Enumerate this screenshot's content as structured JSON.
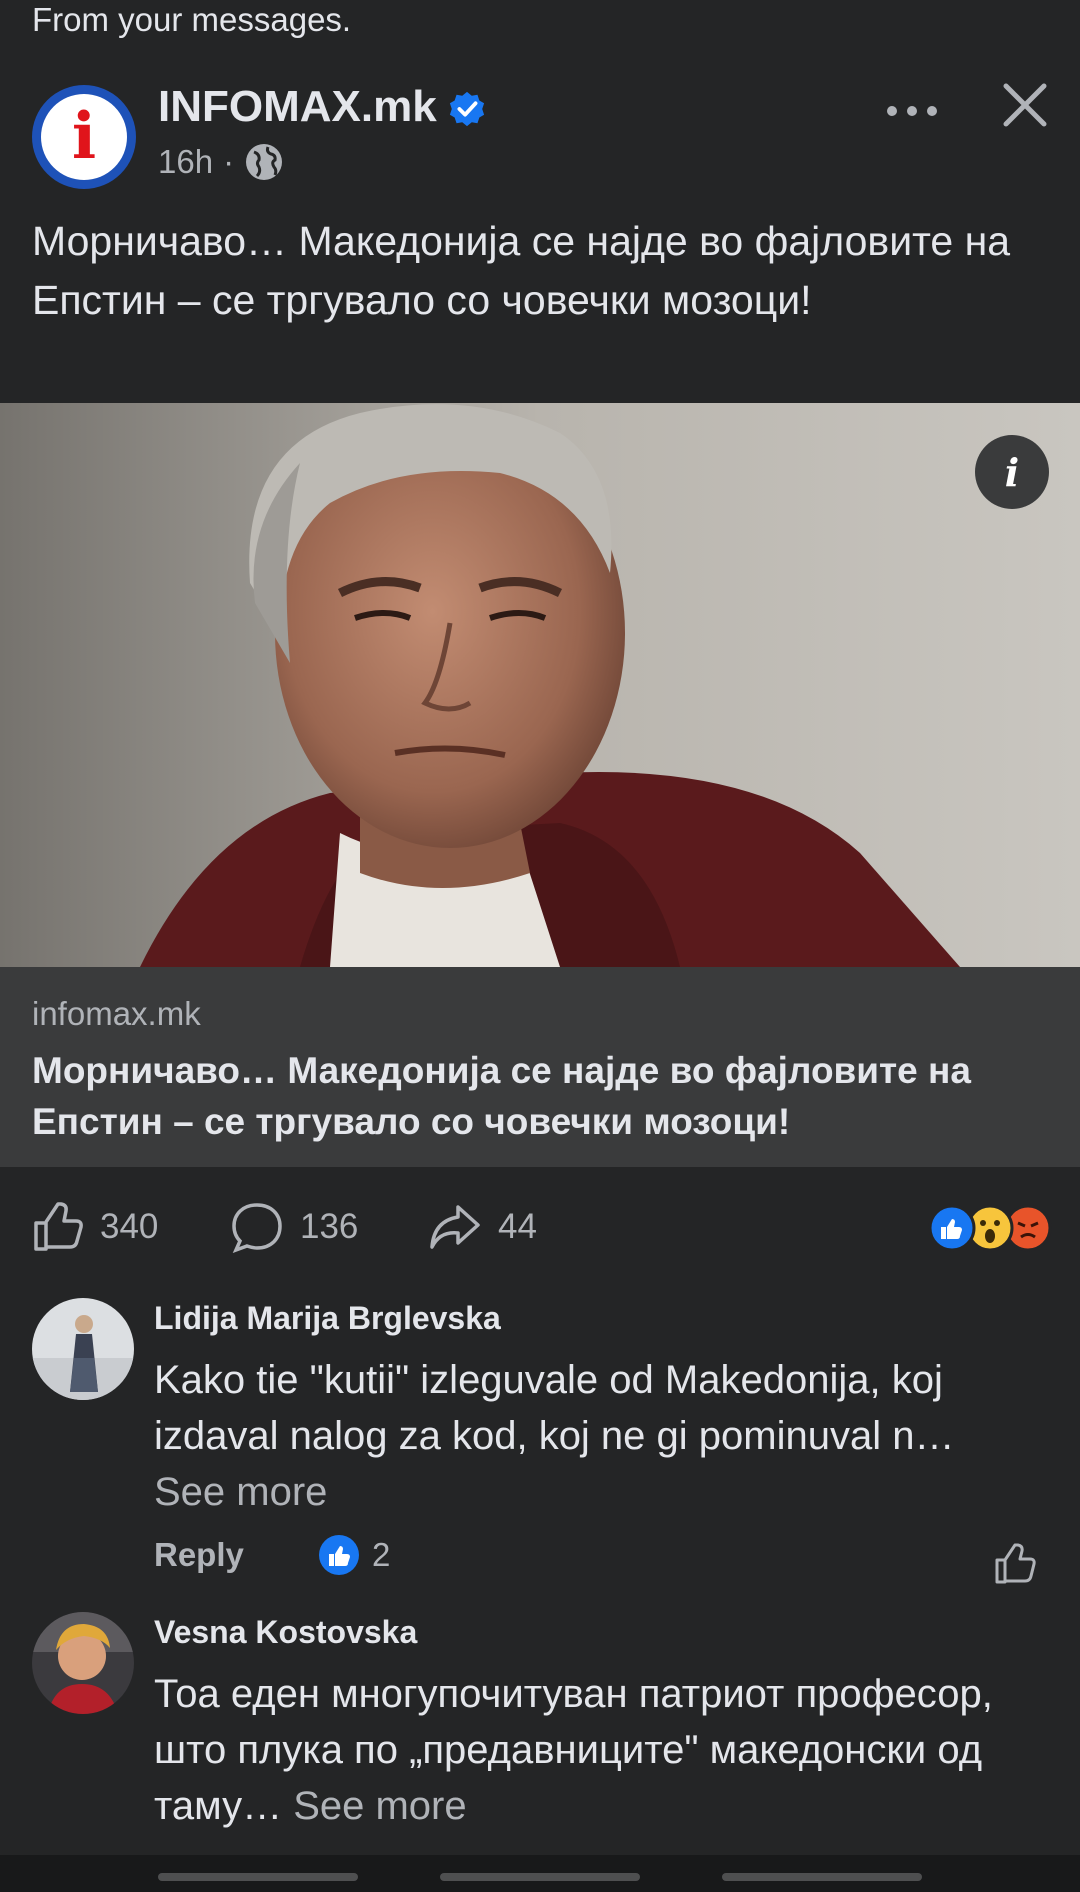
{
  "top_note": "From your messages.",
  "post": {
    "page_name": "INFOMAX.mk",
    "logo_letter": "i",
    "time": "16h",
    "separator": "·",
    "text": "Морничаво… Македонија се најде во фајловите на Епстин – се тргувало со човечки мозоци!",
    "link_domain": "infomax.mk",
    "link_title": "Морничаво… Македонија се најде во фајловите на Епстин – се тргувало со човечки мозоци!",
    "info_glyph": "i",
    "likes": "340",
    "comments": "136",
    "shares": "44"
  },
  "comments": [
    {
      "name": "Lidija Marija Brglevska",
      "text": "Kako tie \"kutii\" izleguvale od Makedonija, koj izdaval nalog za kod, koj ne gi pominuval n…",
      "see_more": "See more",
      "reply": "Reply",
      "likes": "2"
    },
    {
      "name": "Vesna Kostovska",
      "text": "Тоа еден многупочитуван патриот професор, што плука по „предавниците\" македонски  од таму… ",
      "see_more": "See more"
    }
  ],
  "colors": {
    "background": "#242526",
    "card": "#3a3b3c",
    "primary_text": "#e4e6eb",
    "secondary_text": "#b0b3b8",
    "verified": "#1877f2",
    "like_blue": "#1877f2"
  },
  "icons": [
    "verified-badge-icon",
    "globe-icon",
    "more-icon",
    "close-icon",
    "info-icon",
    "like-icon",
    "comment-icon",
    "share-icon",
    "reaction-like-icon",
    "reaction-wow-icon",
    "reaction-angry-icon"
  ]
}
